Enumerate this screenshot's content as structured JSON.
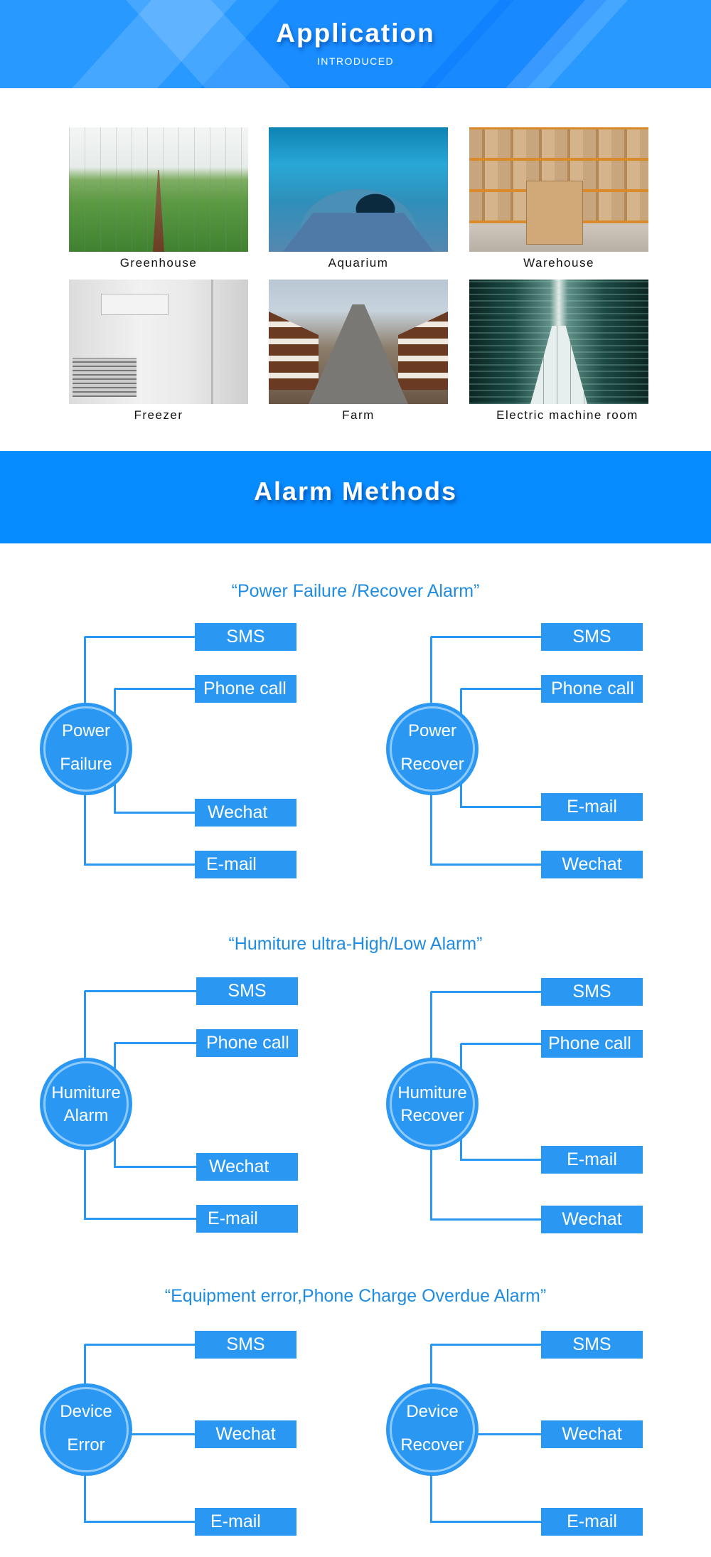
{
  "header": {
    "title": "Application",
    "subtitle": "INTRODUCED"
  },
  "applications": [
    {
      "label": "Greenhouse",
      "image": "greenhouse-photo"
    },
    {
      "label": "Aquarium",
      "image": "aquarium-tunnel-photo"
    },
    {
      "label": "Warehouse",
      "image": "warehouse-shelves-photo"
    },
    {
      "label": "Freezer",
      "image": "cold-room-photo"
    },
    {
      "label": "Farm",
      "image": "cattle-barn-photo"
    },
    {
      "label": "Electric machine room",
      "image": "server-room-photo"
    }
  ],
  "alarm_banner": {
    "title": "Alarm Methods"
  },
  "sections": [
    {
      "heading": "“Power Failure /Recover Alarm”",
      "diagrams": [
        {
          "node": [
            "Power",
            "Failure"
          ],
          "methods": [
            "SMS",
            "Phone call",
            "Wechat",
            "E-mail"
          ]
        },
        {
          "node": [
            "Power",
            "Recover"
          ],
          "methods": [
            "SMS",
            "Phone call",
            "E-mail",
            "Wechat"
          ]
        }
      ]
    },
    {
      "heading": "“Humiture ultra-High/Low Alarm”",
      "diagrams": [
        {
          "node": [
            "Humiture",
            "Alarm"
          ],
          "methods": [
            "SMS",
            "Phone call",
            "Wechat",
            "E-mail"
          ]
        },
        {
          "node": [
            "Humiture",
            "Recover"
          ],
          "methods": [
            "SMS",
            "Phone call",
            "E-mail",
            "Wechat"
          ]
        }
      ]
    },
    {
      "heading": "“Equipment error,Phone Charge Overdue Alarm”",
      "diagrams": [
        {
          "node": [
            "Device",
            "Error"
          ],
          "methods": [
            "SMS",
            "Wechat",
            "E-mail"
          ]
        },
        {
          "node": [
            "Device",
            "Recover"
          ],
          "methods": [
            "SMS",
            "Wechat",
            "E-mail"
          ]
        }
      ]
    }
  ],
  "colors": {
    "header_blue": "#2799ff",
    "banner_blue": "#078cff",
    "diagram_blue": "#2a98f3",
    "ring_light_blue": "#8fcaff",
    "heading_blue": "#1f8ce3"
  }
}
